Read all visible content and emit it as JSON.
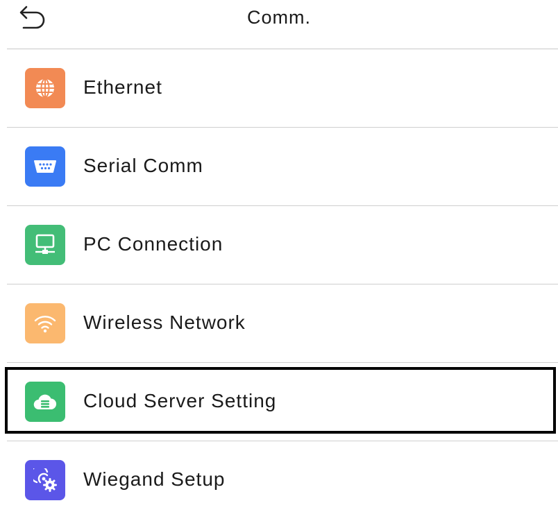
{
  "header": {
    "title": "Comm.",
    "back_icon": "back-arrow-icon"
  },
  "menu": {
    "items": [
      {
        "label": "Ethernet",
        "icon": "globe-icon",
        "color": "#f28a54"
      },
      {
        "label": "Serial Comm",
        "icon": "serial-port-icon",
        "color": "#3a7bf4"
      },
      {
        "label": "PC Connection",
        "icon": "monitor-network-icon",
        "color": "#43bd77"
      },
      {
        "label": "Wireless Network",
        "icon": "wifi-icon",
        "color": "#fbb86f"
      },
      {
        "label": "Cloud Server Setting",
        "icon": "cloud-server-icon",
        "color": "#3bbd71",
        "selected": true
      },
      {
        "label": "Wiegand Setup",
        "icon": "wiegand-gear-icon",
        "color": "#5b56e8"
      }
    ]
  }
}
